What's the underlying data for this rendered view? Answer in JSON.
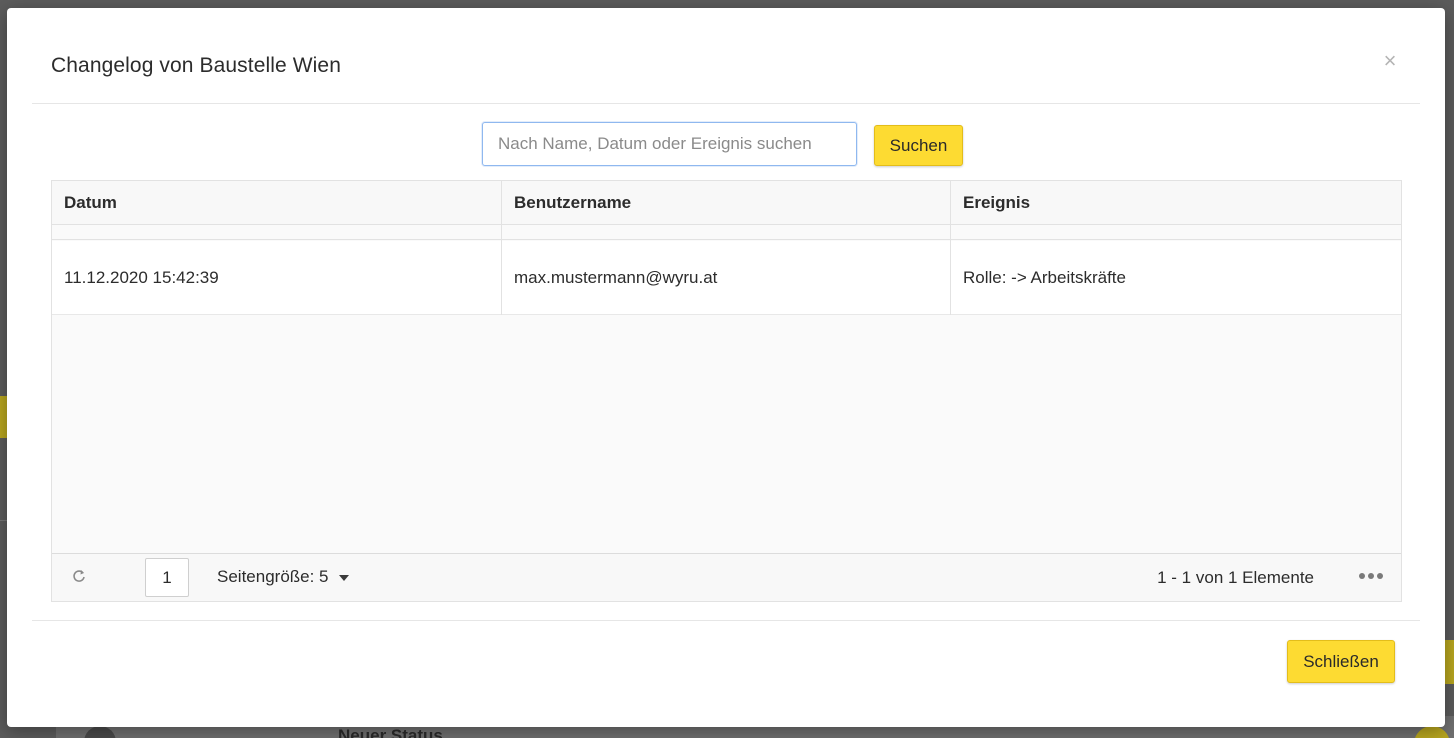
{
  "background": {
    "status_text": "Neuer Status"
  },
  "modal": {
    "title": "Changelog von Baustelle Wien",
    "close_icon": "×"
  },
  "search": {
    "placeholder": "Nach Name, Datum oder Ereignis suchen",
    "value": "",
    "button_label": "Suchen"
  },
  "grid": {
    "columns": [
      "Datum",
      "Benutzername",
      "Ereignis"
    ],
    "rows": [
      {
        "datum": "11.12.2020 15:42:39",
        "benutzername": "max.mustermann@wyru.at",
        "ereignis": "Rolle: -> Arbeitskräfte"
      }
    ]
  },
  "pager": {
    "refresh_icon": "refresh-icon",
    "current_page": "1",
    "page_size_label": "Seitengröße: 5",
    "info": "1 - 1 von 1 Elemente",
    "more_icon": "ellipsis-icon"
  },
  "footer": {
    "close_button_label": "Schließen"
  },
  "colors": {
    "accent_yellow": "#fddb32",
    "input_focus_border": "#8fb8ef",
    "overlay": "#5c5c5c"
  }
}
